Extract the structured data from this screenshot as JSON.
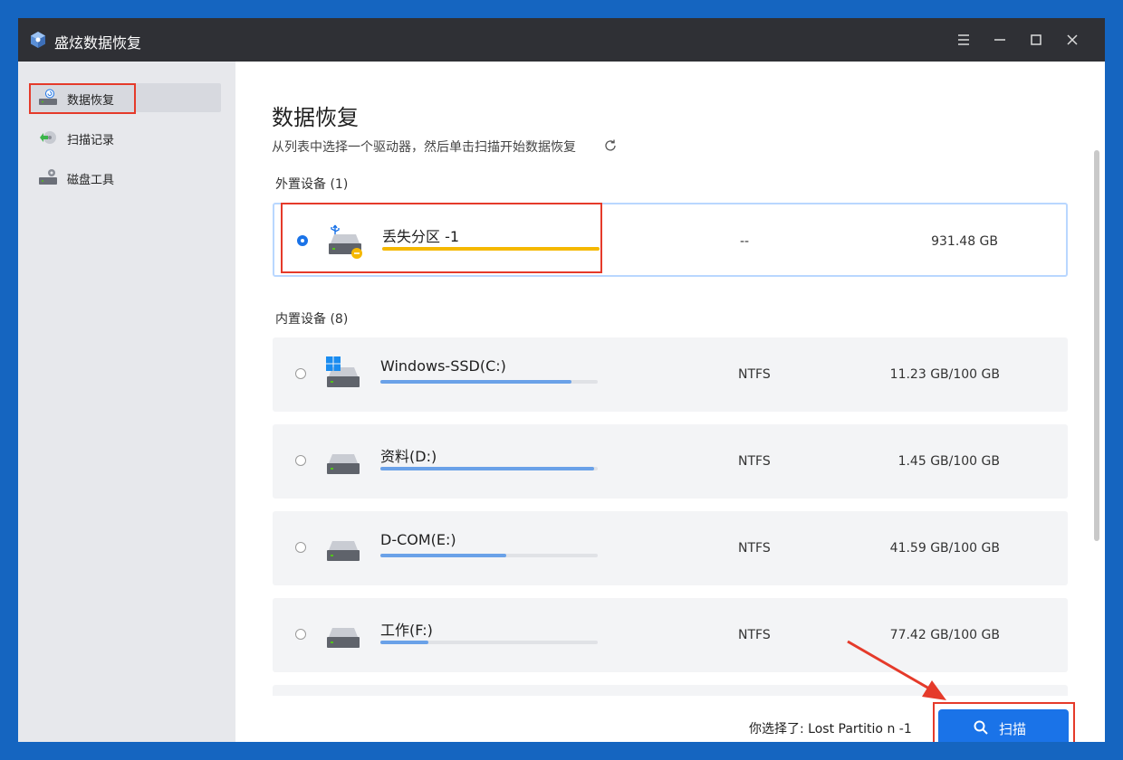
{
  "titlebar": {
    "app_title": "盛炫数据恢复",
    "window_controls": [
      "menu-icon",
      "minimize-icon",
      "maximize-icon",
      "close-icon"
    ]
  },
  "sidebar": {
    "items": [
      {
        "label": "数据恢复",
        "icon": "drive-restore-icon",
        "active": true
      },
      {
        "label": "扫描记录",
        "icon": "scan-history-icon",
        "active": false
      },
      {
        "label": "磁盘工具",
        "icon": "disk-tools-icon",
        "active": false
      }
    ]
  },
  "main": {
    "title": "数据恢复",
    "subtitle": "从列表中选择一个驱动器，然后单击扫描开始数据恢复",
    "external_label": "外置设备 (1)",
    "internal_label": "内置设备 (8)",
    "external_drives": [
      {
        "name": "丢失分区 -1",
        "fs": "--",
        "size": "931.48 GB",
        "usage": 1.0,
        "bar_color": "#f5b800",
        "selected": true,
        "icon": "usb-drive-icon"
      }
    ],
    "internal_drives": [
      {
        "name": "Windows-SSD(C:)",
        "fs": "NTFS",
        "size": "11.23 GB/100 GB",
        "usage": 0.88,
        "bar_color": "#6aa1e8",
        "selected": false,
        "icon": "windows-drive-icon"
      },
      {
        "name": "资料(D:)",
        "fs": "NTFS",
        "size": "1.45 GB/100 GB",
        "usage": 0.985,
        "bar_color": "#6aa1e8",
        "selected": false,
        "icon": "hard-drive-icon"
      },
      {
        "name": "D-COM(E:)",
        "fs": "NTFS",
        "size": "41.59 GB/100 GB",
        "usage": 0.58,
        "bar_color": "#6aa1e8",
        "selected": false,
        "icon": "hard-drive-icon"
      },
      {
        "name": "工作(F:)",
        "fs": "NTFS",
        "size": "77.42 GB/100 GB",
        "usage": 0.22,
        "bar_color": "#6aa1e8",
        "selected": false,
        "icon": "hard-drive-icon"
      }
    ]
  },
  "footer": {
    "selection_text": "你选择了: Lost Partitio n -1",
    "scan_label": "扫描"
  },
  "colors": {
    "accent": "#1a73e8",
    "highlight_box": "#e53a2a",
    "title_bar": "#2f3035",
    "sidebar_bg": "#e7e8ec"
  }
}
